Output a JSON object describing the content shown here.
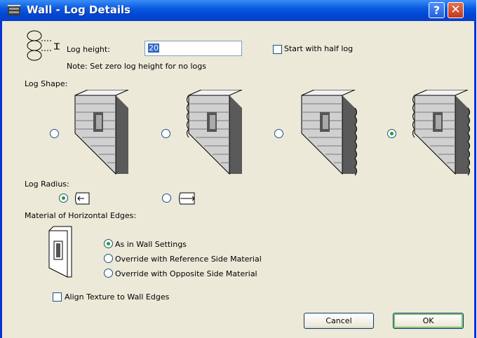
{
  "window": {
    "title": "Wall - Log Details"
  },
  "log_height": {
    "label": "Log height:",
    "value": "20",
    "note": "Note: Set zero log height for no logs"
  },
  "half_log": {
    "label": "Start with half log",
    "checked": false
  },
  "log_shape": {
    "label": "Log Shape:",
    "selected_index": 3
  },
  "log_radius": {
    "label": "Log Radius:",
    "selected_index": 0
  },
  "edges": {
    "label": "Material of Horizontal Edges:",
    "options": [
      "As in Wall Settings",
      "Override with Reference Side Material",
      "Override with Opposite Side Material"
    ],
    "selected_index": 0
  },
  "align_texture": {
    "label": "Align Texture to Wall Edges",
    "checked": false
  },
  "buttons": {
    "cancel": "Cancel",
    "ok": "OK"
  }
}
